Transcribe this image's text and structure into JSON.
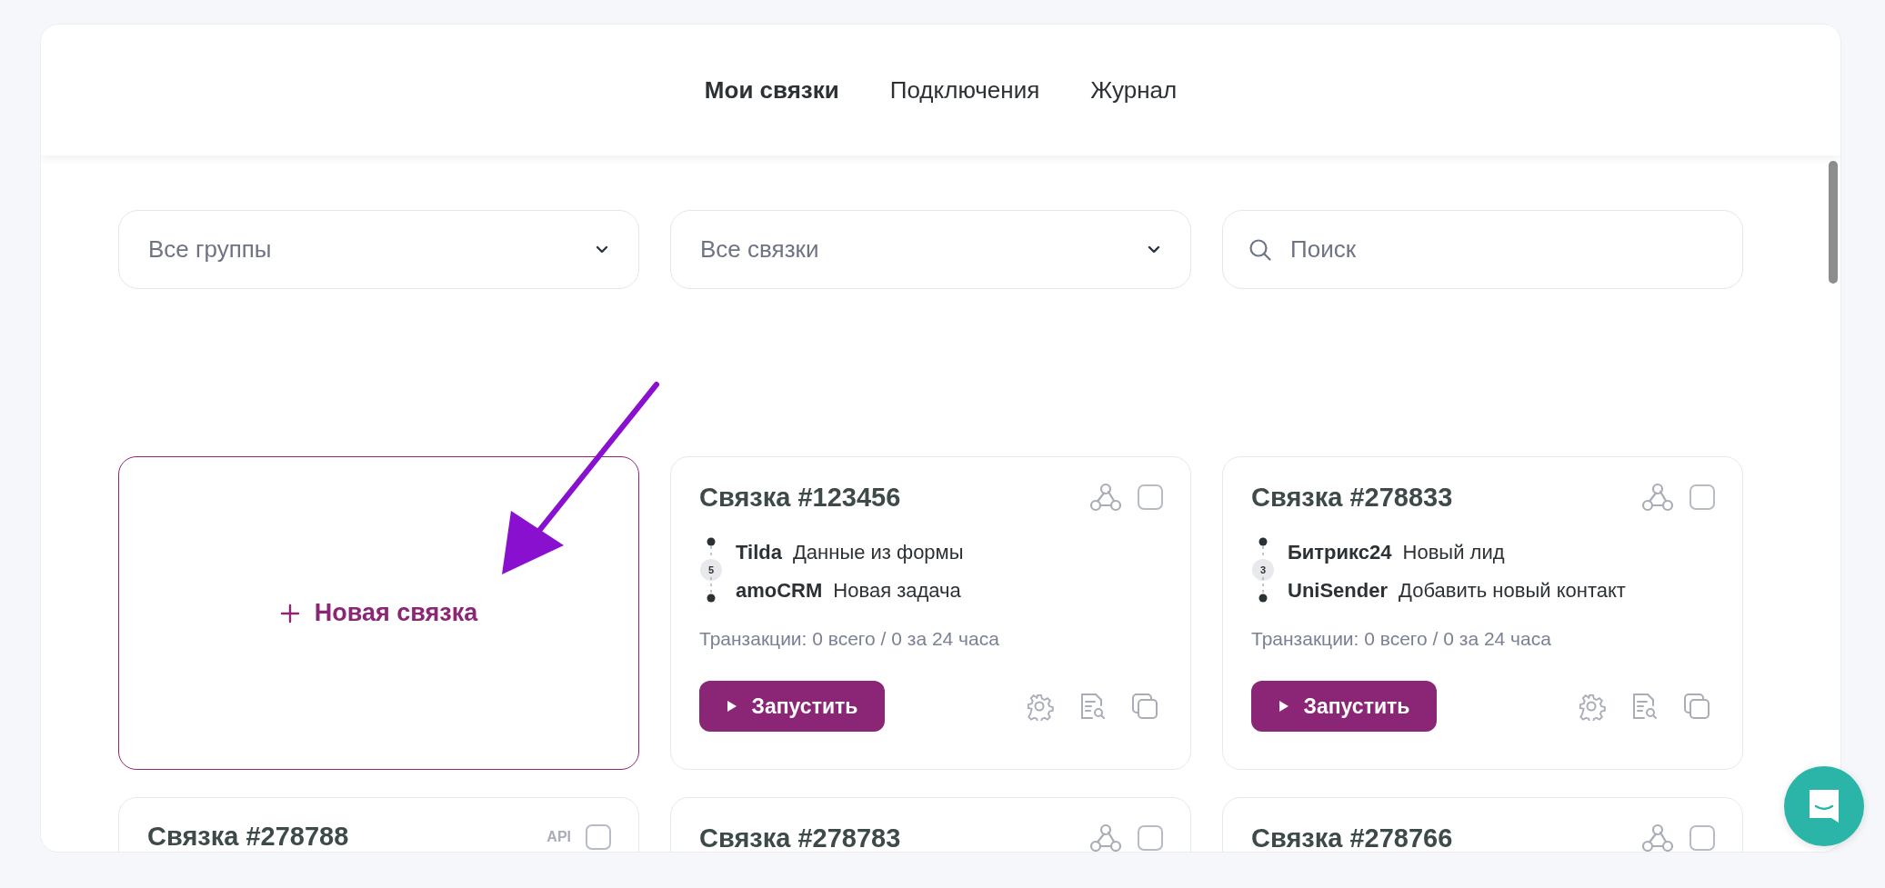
{
  "tabs": [
    {
      "label": "Мои связки",
      "selected": true
    },
    {
      "label": "Подключения",
      "selected": false
    },
    {
      "label": "Журнал",
      "selected": false
    }
  ],
  "filters": [
    {
      "kind": "dropdown",
      "value": "Все группы"
    },
    {
      "kind": "dropdown",
      "value": "Все связки"
    },
    {
      "kind": "search",
      "placeholder": "Поиск"
    }
  ],
  "new_card": {
    "label": "Новая связка"
  },
  "cards": [
    {
      "title": "Связка #123456",
      "mark": {
        "kind": "webhook"
      },
      "checked": false,
      "count": "5",
      "steps": [
        {
          "app": "Tilda",
          "action": "Данные из формы"
        },
        {
          "app": "amoCRM",
          "action": "Новая задача"
        }
      ],
      "transactions": "Транзакции: 0 всего / 0 за 24 часа",
      "run_label": "Запустить"
    },
    {
      "title": "Связка #278833",
      "mark": {
        "kind": "webhook"
      },
      "checked": false,
      "count": "3",
      "steps": [
        {
          "app": "Битрикс24",
          "action": "Новый лид"
        },
        {
          "app": "UniSender",
          "action": "Добавить новый контакт"
        }
      ],
      "transactions": "Транзакции: 0 всего / 0 за 24 часа",
      "run_label": "Запустить"
    },
    {
      "title": "Связка #278788",
      "mark": {
        "kind": "api",
        "text": "API"
      },
      "checked": false
    },
    {
      "title": "Связка #278783",
      "mark": {
        "kind": "webhook"
      },
      "checked": false
    },
    {
      "title": "Связка #278766",
      "mark": {
        "kind": "webhook"
      },
      "checked": false
    }
  ]
}
